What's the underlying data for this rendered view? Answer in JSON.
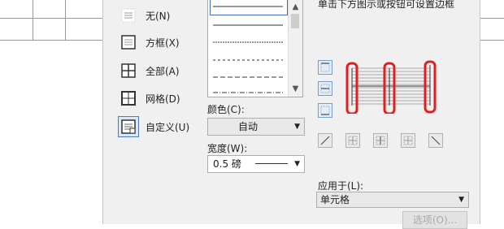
{
  "settings": [
    {
      "label": "无(N)",
      "icon": "no-border-icon"
    },
    {
      "label": "方框(X)",
      "icon": "box-border-icon"
    },
    {
      "label": "全部(A)",
      "icon": "all-borders-icon"
    },
    {
      "label": "网格(D)",
      "icon": "grid-border-icon"
    },
    {
      "label": "自定义(U)",
      "icon": "custom-border-icon",
      "selected": true
    }
  ],
  "line_styles": [
    "solid",
    "dashed-fine",
    "dashed",
    "dash-dot",
    "dash-dot-dot"
  ],
  "color": {
    "label": "颜色(C):",
    "value": "自动"
  },
  "width": {
    "label": "宽度(W):",
    "value": "0.5  磅"
  },
  "preview": {
    "hint": "单击下方图示或按钮可设置边框"
  },
  "apply_to": {
    "label": "应用于(L):",
    "value": "单元格"
  },
  "options_button": "选项(O)...",
  "colors": {
    "accent": "#3d6fb5",
    "highlight": "#e0201e",
    "dialog_bg": "#f0f0f0"
  }
}
